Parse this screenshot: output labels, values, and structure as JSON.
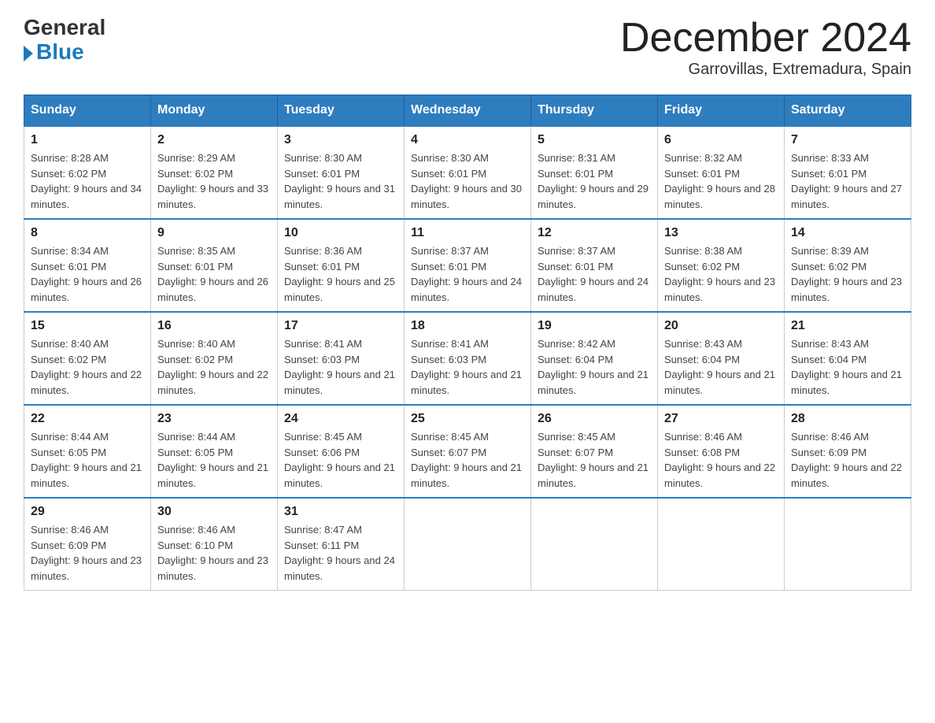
{
  "header": {
    "logo_general": "General",
    "logo_blue": "Blue",
    "month_title": "December 2024",
    "subtitle": "Garrovillas, Extremadura, Spain"
  },
  "days_of_week": [
    "Sunday",
    "Monday",
    "Tuesday",
    "Wednesday",
    "Thursday",
    "Friday",
    "Saturday"
  ],
  "weeks": [
    [
      {
        "num": "1",
        "sunrise": "8:28 AM",
        "sunset": "6:02 PM",
        "daylight": "9 hours and 34 minutes."
      },
      {
        "num": "2",
        "sunrise": "8:29 AM",
        "sunset": "6:02 PM",
        "daylight": "9 hours and 33 minutes."
      },
      {
        "num": "3",
        "sunrise": "8:30 AM",
        "sunset": "6:01 PM",
        "daylight": "9 hours and 31 minutes."
      },
      {
        "num": "4",
        "sunrise": "8:30 AM",
        "sunset": "6:01 PM",
        "daylight": "9 hours and 30 minutes."
      },
      {
        "num": "5",
        "sunrise": "8:31 AM",
        "sunset": "6:01 PM",
        "daylight": "9 hours and 29 minutes."
      },
      {
        "num": "6",
        "sunrise": "8:32 AM",
        "sunset": "6:01 PM",
        "daylight": "9 hours and 28 minutes."
      },
      {
        "num": "7",
        "sunrise": "8:33 AM",
        "sunset": "6:01 PM",
        "daylight": "9 hours and 27 minutes."
      }
    ],
    [
      {
        "num": "8",
        "sunrise": "8:34 AM",
        "sunset": "6:01 PM",
        "daylight": "9 hours and 26 minutes."
      },
      {
        "num": "9",
        "sunrise": "8:35 AM",
        "sunset": "6:01 PM",
        "daylight": "9 hours and 26 minutes."
      },
      {
        "num": "10",
        "sunrise": "8:36 AM",
        "sunset": "6:01 PM",
        "daylight": "9 hours and 25 minutes."
      },
      {
        "num": "11",
        "sunrise": "8:37 AM",
        "sunset": "6:01 PM",
        "daylight": "9 hours and 24 minutes."
      },
      {
        "num": "12",
        "sunrise": "8:37 AM",
        "sunset": "6:01 PM",
        "daylight": "9 hours and 24 minutes."
      },
      {
        "num": "13",
        "sunrise": "8:38 AM",
        "sunset": "6:02 PM",
        "daylight": "9 hours and 23 minutes."
      },
      {
        "num": "14",
        "sunrise": "8:39 AM",
        "sunset": "6:02 PM",
        "daylight": "9 hours and 23 minutes."
      }
    ],
    [
      {
        "num": "15",
        "sunrise": "8:40 AM",
        "sunset": "6:02 PM",
        "daylight": "9 hours and 22 minutes."
      },
      {
        "num": "16",
        "sunrise": "8:40 AM",
        "sunset": "6:02 PM",
        "daylight": "9 hours and 22 minutes."
      },
      {
        "num": "17",
        "sunrise": "8:41 AM",
        "sunset": "6:03 PM",
        "daylight": "9 hours and 21 minutes."
      },
      {
        "num": "18",
        "sunrise": "8:41 AM",
        "sunset": "6:03 PM",
        "daylight": "9 hours and 21 minutes."
      },
      {
        "num": "19",
        "sunrise": "8:42 AM",
        "sunset": "6:04 PM",
        "daylight": "9 hours and 21 minutes."
      },
      {
        "num": "20",
        "sunrise": "8:43 AM",
        "sunset": "6:04 PM",
        "daylight": "9 hours and 21 minutes."
      },
      {
        "num": "21",
        "sunrise": "8:43 AM",
        "sunset": "6:04 PM",
        "daylight": "9 hours and 21 minutes."
      }
    ],
    [
      {
        "num": "22",
        "sunrise": "8:44 AM",
        "sunset": "6:05 PM",
        "daylight": "9 hours and 21 minutes."
      },
      {
        "num": "23",
        "sunrise": "8:44 AM",
        "sunset": "6:05 PM",
        "daylight": "9 hours and 21 minutes."
      },
      {
        "num": "24",
        "sunrise": "8:45 AM",
        "sunset": "6:06 PM",
        "daylight": "9 hours and 21 minutes."
      },
      {
        "num": "25",
        "sunrise": "8:45 AM",
        "sunset": "6:07 PM",
        "daylight": "9 hours and 21 minutes."
      },
      {
        "num": "26",
        "sunrise": "8:45 AM",
        "sunset": "6:07 PM",
        "daylight": "9 hours and 21 minutes."
      },
      {
        "num": "27",
        "sunrise": "8:46 AM",
        "sunset": "6:08 PM",
        "daylight": "9 hours and 22 minutes."
      },
      {
        "num": "28",
        "sunrise": "8:46 AM",
        "sunset": "6:09 PM",
        "daylight": "9 hours and 22 minutes."
      }
    ],
    [
      {
        "num": "29",
        "sunrise": "8:46 AM",
        "sunset": "6:09 PM",
        "daylight": "9 hours and 23 minutes."
      },
      {
        "num": "30",
        "sunrise": "8:46 AM",
        "sunset": "6:10 PM",
        "daylight": "9 hours and 23 minutes."
      },
      {
        "num": "31",
        "sunrise": "8:47 AM",
        "sunset": "6:11 PM",
        "daylight": "9 hours and 24 minutes."
      },
      null,
      null,
      null,
      null
    ]
  ]
}
